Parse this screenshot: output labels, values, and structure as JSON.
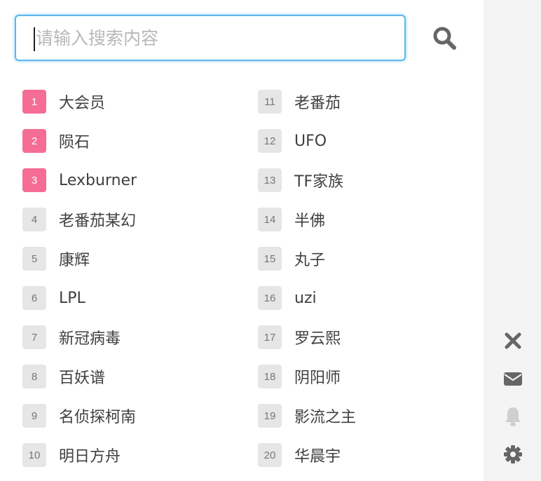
{
  "search": {
    "placeholder": "请输入搜索内容",
    "value": ""
  },
  "hot_search": {
    "items": [
      {
        "rank": "1",
        "label": "大会员",
        "hot": true
      },
      {
        "rank": "2",
        "label": "陨石",
        "hot": true
      },
      {
        "rank": "3",
        "label": "Lexburner",
        "hot": true
      },
      {
        "rank": "4",
        "label": "老番茄某幻",
        "hot": false
      },
      {
        "rank": "5",
        "label": "康辉",
        "hot": false
      },
      {
        "rank": "6",
        "label": "LPL",
        "hot": false
      },
      {
        "rank": "7",
        "label": "新冠病毒",
        "hot": false
      },
      {
        "rank": "8",
        "label": "百妖谱",
        "hot": false
      },
      {
        "rank": "9",
        "label": "名侦探柯南",
        "hot": false
      },
      {
        "rank": "10",
        "label": "明日方舟",
        "hot": false
      },
      {
        "rank": "11",
        "label": "老番茄",
        "hot": false
      },
      {
        "rank": "12",
        "label": "UFO",
        "hot": false
      },
      {
        "rank": "13",
        "label": "TF家族",
        "hot": false
      },
      {
        "rank": "14",
        "label": "半佛",
        "hot": false
      },
      {
        "rank": "15",
        "label": "丸子",
        "hot": false
      },
      {
        "rank": "16",
        "label": "uzi",
        "hot": false
      },
      {
        "rank": "17",
        "label": "罗云熙",
        "hot": false
      },
      {
        "rank": "18",
        "label": "阴阳师",
        "hot": false
      },
      {
        "rank": "19",
        "label": "影流之主",
        "hot": false
      },
      {
        "rank": "20",
        "label": "华晨宇",
        "hot": false
      }
    ]
  },
  "sidebar": {
    "icons": [
      "close-icon",
      "mail-icon",
      "bell-icon",
      "gear-icon"
    ]
  },
  "colors": {
    "hot_badge": "#f56d96",
    "normal_badge": "#e6e6e6",
    "focus_border": "#5bb8ef",
    "sidebar_bg": "#f4f4f4",
    "icon_dark": "#666666",
    "icon_light": "#cfcfcf"
  }
}
